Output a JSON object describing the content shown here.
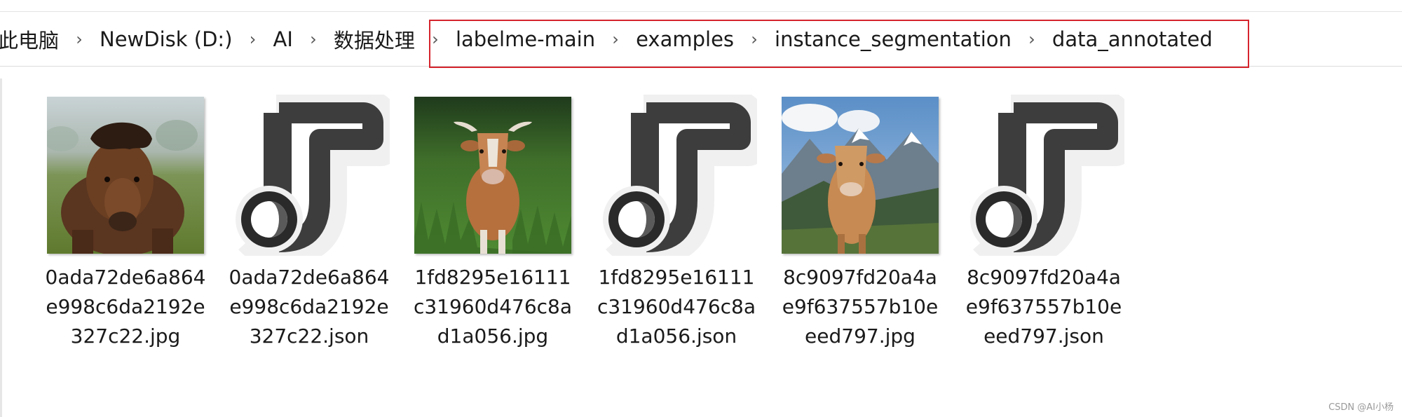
{
  "breadcrumb": {
    "items": [
      {
        "label": "此电脑"
      },
      {
        "label": "NewDisk (D:)"
      },
      {
        "label": "AI"
      },
      {
        "label": "数据处理"
      },
      {
        "label": "labelme-main"
      },
      {
        "label": "examples"
      },
      {
        "label": "instance_segmentation"
      },
      {
        "label": "data_annotated"
      }
    ],
    "separator": "›"
  },
  "files": [
    {
      "name": "0ada72de6a864e998c6da2192e327c22.jpg",
      "icon": "horse-photo-thumbnail"
    },
    {
      "name": "0ada72de6a864e998c6da2192e327c22.json",
      "icon": "json-file-icon"
    },
    {
      "name": "1fd8295e16111c31960d476c8ad1a056.jpg",
      "icon": "cow-in-grass-photo-thumbnail"
    },
    {
      "name": "1fd8295e16111c31960d476c8ad1a056.json",
      "icon": "json-file-icon"
    },
    {
      "name": "8c9097fd20a4ae9f637557b10eeed797.jpg",
      "icon": "cow-mountains-photo-thumbnail"
    },
    {
      "name": "8c9097fd20a4ae9f637557b10eeed797.json",
      "icon": "json-file-icon"
    }
  ],
  "watermark": "CSDN @AI小杨",
  "colors": {
    "highlight_border": "#d6242d",
    "json_icon_dark": "#3d3d3d"
  }
}
